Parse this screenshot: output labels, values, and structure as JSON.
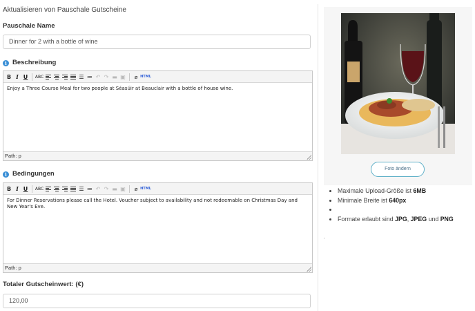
{
  "form": {
    "heading": "Aktualisieren von Pauschale Gutscheine",
    "name_label": "Pauschale Name",
    "name_value": "Dinner for 2 with a bottle of wine",
    "description_label": "Beschreibung",
    "description_text": "Enjoy a Three Course Meal for two people at Séasúir at Beauclair with a bottle of house wine.",
    "conditions_label": "Bedingungen",
    "conditions_text": "For Dinner Reservations please call the Hotel. Voucher subject to availability and not redeemable on Christmas Day and New Year's Eve.",
    "path_label": "Path: p",
    "total_label": "Totaler Gutscheinwert: (€)",
    "total_value": "120,00",
    "info_icon_glyph": "i"
  },
  "toolbar": {
    "bold": "B",
    "italic": "I",
    "underline": "U",
    "strike": "ABC",
    "html": "HTML"
  },
  "photo": {
    "change_button": "Foto ändern"
  },
  "rules": {
    "upload_size_prefix": "Maximale Upload-Größe ist ",
    "upload_size_value": "6MB",
    "min_width_prefix": "Minimale Breite ist ",
    "min_width_value": "640px",
    "formats_prefix": "Formate erlaubt sind ",
    "format_jpg": "JPG",
    "format_sep": ", ",
    "format_jpeg": "JPEG",
    "format_and": " und ",
    "format_png": "PNG"
  },
  "colors": {
    "info_icon": "#3a8fd6",
    "button_border": "#5fb0c8",
    "html_button": "#2a5bd7"
  }
}
